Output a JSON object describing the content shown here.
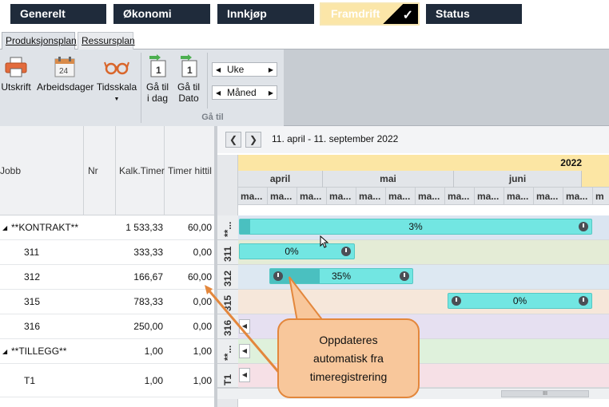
{
  "nav": {
    "generelt": "Generelt",
    "okonomi": "Økonomi",
    "innkjop": "Innkjøp",
    "framdrift": "Framdrift",
    "status": "Status"
  },
  "tabs": {
    "produksjonsplan": "Produksjonsplan",
    "ressursplan": "Ressursplan"
  },
  "ribbon": {
    "utskrift": "Utskrift",
    "arbeidsdager": "Arbeidsdager",
    "tidsskala": "Tidsskala",
    "calendar_day": "24",
    "ga_til_idag_1": "Gå til",
    "ga_til_idag_2": "i dag",
    "ga_til_dato_1": "Gå til",
    "ga_til_dato_2": "Dato",
    "uke": "Uke",
    "maned": "Måned",
    "group_label": "Gå til",
    "flag_num": "1"
  },
  "grid": {
    "headers": {
      "jobb": "Jobb",
      "nr": "Nr",
      "kalk": "Kalk.Timer",
      "timer": "Timer hittil"
    },
    "rows": [
      {
        "jobb": "**KONTRAKT**",
        "kalk": "1 533,33",
        "timer": "60,00"
      },
      {
        "jobb": "311",
        "kalk": "333,33",
        "timer": "0,00"
      },
      {
        "jobb": "312",
        "kalk": "166,67",
        "timer": "60,00"
      },
      {
        "jobb": "315",
        "kalk": "783,33",
        "timer": "0,00"
      },
      {
        "jobb": "316",
        "kalk": "250,00",
        "timer": "0,00"
      },
      {
        "jobb": "**TILLEGG**",
        "kalk": "1,00",
        "timer": "1,00"
      },
      {
        "jobb": "T1",
        "kalk": "1,00",
        "timer": "1,00"
      }
    ]
  },
  "gantt": {
    "range": "11. april - 11. september 2022",
    "year": "2022",
    "months": {
      "april": "april",
      "mai": "mai",
      "juni": "juni"
    },
    "week_label": "ma...",
    "week_label_cut": "m",
    "row_labels": {
      "r0": "**...",
      "r1": "311",
      "r2": "312",
      "r3": "315",
      "r4": "316",
      "r5": "**...",
      "r6": "T1"
    },
    "bars": {
      "b0": "3%",
      "b1": "0%",
      "b2": "35%",
      "b3": "0%"
    },
    "progress": {
      "b0": 0.03,
      "b1": 0.0,
      "b2": 0.35,
      "b3": 0.0
    },
    "scroll_grip": "III"
  },
  "callout": {
    "line1": "Oppdateres",
    "line2": "automatisk fra",
    "line3": "timeregistrering"
  }
}
